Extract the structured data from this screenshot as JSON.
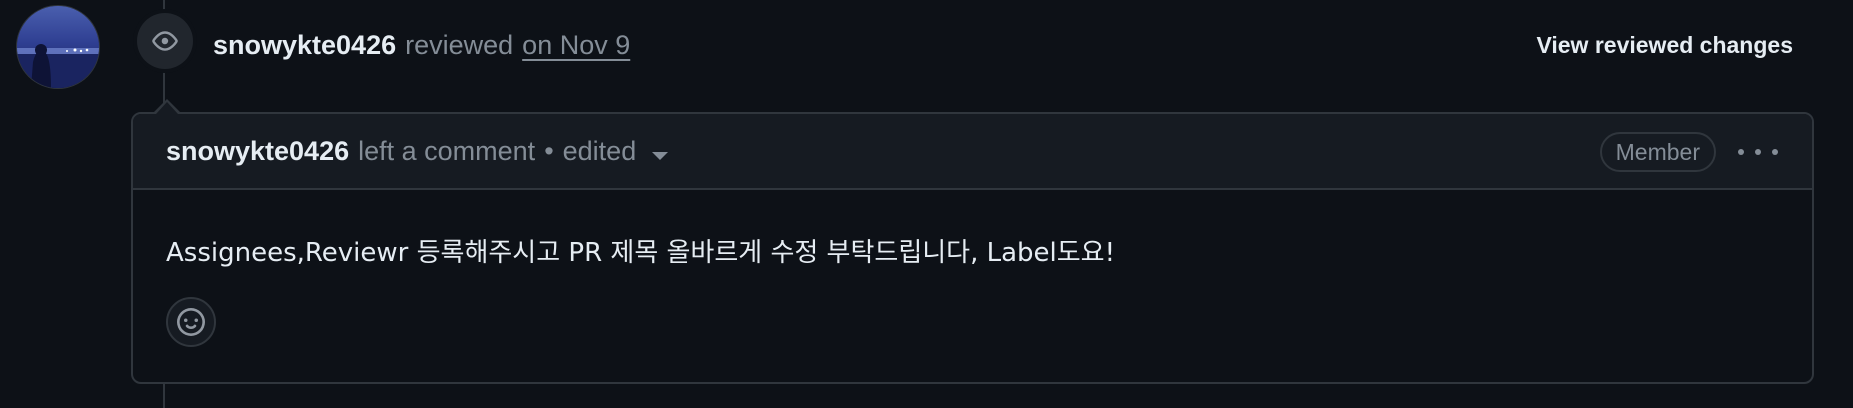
{
  "review": {
    "author": "snowykte0426",
    "verb": "reviewed",
    "date": "on Nov 9",
    "view_changes_label": "View reviewed changes"
  },
  "comment": {
    "author": "snowykte0426",
    "verb": "left a comment",
    "separator": "•",
    "edited_label": "edited",
    "role_badge": "Member",
    "body": "Assignees,Reviewr 등록해주시고 PR 제목 올바르게 수정 부탁드립니다, Label도요!"
  },
  "icons": {
    "review_event": "eye-icon",
    "more_options": "kebab-horizontal-icon",
    "edited_dropdown": "triangle-down-icon",
    "add_reaction": "smiley-icon"
  },
  "colors": {
    "background": "#0d1117",
    "header_background": "#161b22",
    "border": "#30363d",
    "text_primary": "#e6edf3",
    "text_muted": "#848d97"
  }
}
